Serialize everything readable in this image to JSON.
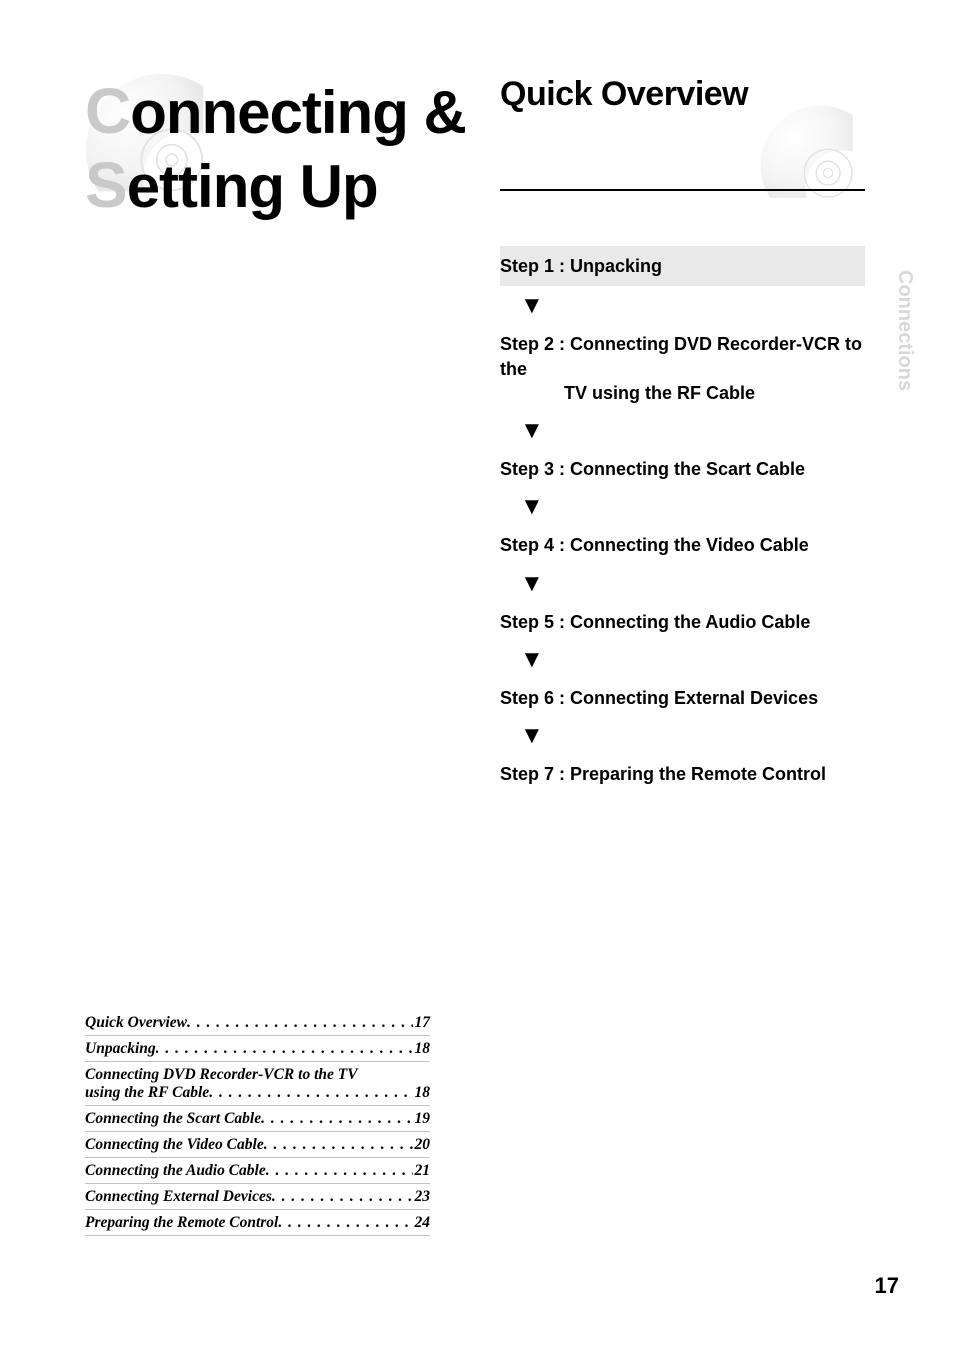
{
  "main_title": {
    "line1_cap": "C",
    "line1_rest": "onnecting &",
    "line2_cap": "S",
    "line2_rest": "etting Up"
  },
  "section_title": "Quick Overview",
  "steps": [
    {
      "label": "Step 1 : Unpacking",
      "sub": "",
      "banded": true
    },
    {
      "label": "Step 2 : Connecting DVD Recorder-VCR to the",
      "sub": "TV using the RF Cable",
      "banded": false
    },
    {
      "label": "Step 3 : Connecting the Scart Cable",
      "sub": "",
      "banded": false
    },
    {
      "label": "Step 4 : Connecting the Video Cable",
      "sub": "",
      "banded": false
    },
    {
      "label": "Step 5 : Connecting the Audio Cable",
      "sub": "",
      "banded": false
    },
    {
      "label": "Step 6 : Connecting External Devices",
      "sub": "",
      "banded": false
    },
    {
      "label": "Step 7 : Preparing the Remote Control",
      "sub": "",
      "banded": false
    }
  ],
  "toc": [
    {
      "label": "Quick Overview",
      "page": "17",
      "cont": null
    },
    {
      "label": "Unpacking",
      "page": "18",
      "cont": null
    },
    {
      "label": "Connecting DVD Recorder-VCR to the TV",
      "page": null,
      "cont": {
        "label": "using the RF Cable",
        "page": "18"
      }
    },
    {
      "label": "Connecting the Scart Cable",
      "page": "19",
      "cont": null
    },
    {
      "label": "Connecting the Video Cable",
      "page": "20",
      "cont": null
    },
    {
      "label": "Connecting the Audio Cable",
      "page": "21",
      "cont": null
    },
    {
      "label": "Connecting External Devices",
      "page": "23",
      "cont": null
    },
    {
      "label": "Preparing the Remote Control",
      "page": "24",
      "cont": null
    }
  ],
  "side_label": "Connections",
  "page_number": "17"
}
